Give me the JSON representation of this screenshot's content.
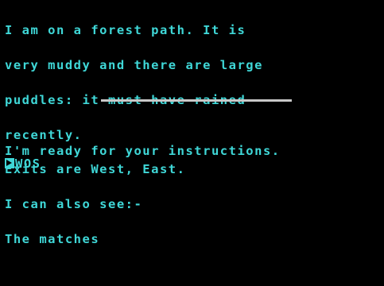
{
  "room": {
    "lines": [
      "I am on a forest path. It is",
      "very muddy and there are large",
      "puddles: it must have rained",
      "recently.",
      "Exits are West, East.",
      "I can also see:-",
      "The matches"
    ]
  },
  "prompt": {
    "message": "I'm ready for your instructions.",
    "input": "WOS"
  },
  "colors": {
    "text": "#3fd7d7",
    "background": "#000000",
    "divider": "#c8c8c8"
  },
  "icons": {
    "cursor": "prompt-cursor-icon"
  }
}
